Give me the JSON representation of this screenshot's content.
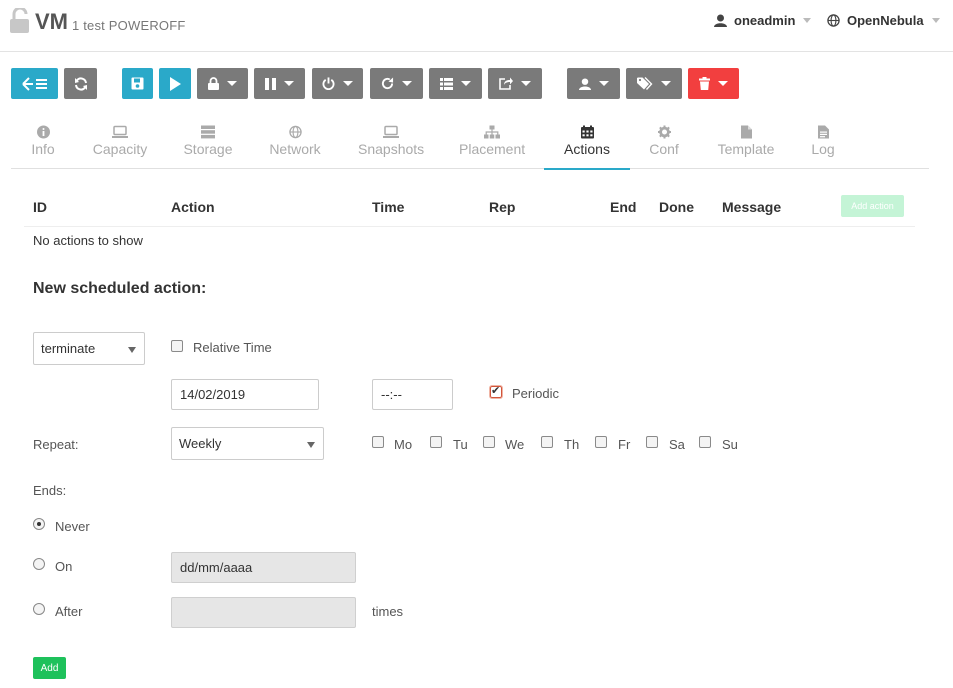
{
  "header": {
    "title": "VM",
    "subtitle": "1 test POWEROFF",
    "user": "oneadmin",
    "zone": "OpenNebula"
  },
  "toolbar": {
    "icons": [
      "back-list-icon",
      "refresh-icon",
      "save-icon",
      "play-icon",
      "lock-icon",
      "pause-icon",
      "power-icon",
      "reboot-icon",
      "list-icon",
      "export-icon",
      "user-icon",
      "tag-icon",
      "trash-icon"
    ]
  },
  "tabs": [
    {
      "label": "Info",
      "icon": "info-icon"
    },
    {
      "label": "Capacity",
      "icon": "laptop-icon"
    },
    {
      "label": "Storage",
      "icon": "storage-icon"
    },
    {
      "label": "Network",
      "icon": "globe-icon"
    },
    {
      "label": "Snapshots",
      "icon": "laptop-icon"
    },
    {
      "label": "Placement",
      "icon": "sitemap-icon"
    },
    {
      "label": "Actions",
      "icon": "calendar-icon",
      "active": true
    },
    {
      "label": "Conf",
      "icon": "gear-icon"
    },
    {
      "label": "Template",
      "icon": "file-icon"
    },
    {
      "label": "Log",
      "icon": "file-text-icon"
    }
  ],
  "table": {
    "columns": [
      "ID",
      "Action",
      "Time",
      "Rep",
      "End",
      "Done",
      "Message"
    ],
    "add_action_label": "Add action",
    "empty_text": "No actions to show"
  },
  "form": {
    "title": "New scheduled action:",
    "action_select": "terminate",
    "relative_time_label": "Relative Time",
    "date_value": "14/02/2019",
    "time_value": "--:--",
    "periodic_label": "Periodic",
    "repeat_label": "Repeat:",
    "repeat_value": "Weekly",
    "days": [
      "Mo",
      "Tu",
      "We",
      "Th",
      "Fr",
      "Sa",
      "Su"
    ],
    "ends_label": "Ends:",
    "never_label": "Never",
    "on_label": "On",
    "on_placeholder": "dd/mm/aaaa",
    "after_label": "After",
    "times_label": "times",
    "add_label": "Add"
  },
  "colors": {
    "accent": "#2aa9c9",
    "gray_button": "#7a7a7a",
    "danger": "#f23f3f",
    "success": "#1ec15b"
  }
}
